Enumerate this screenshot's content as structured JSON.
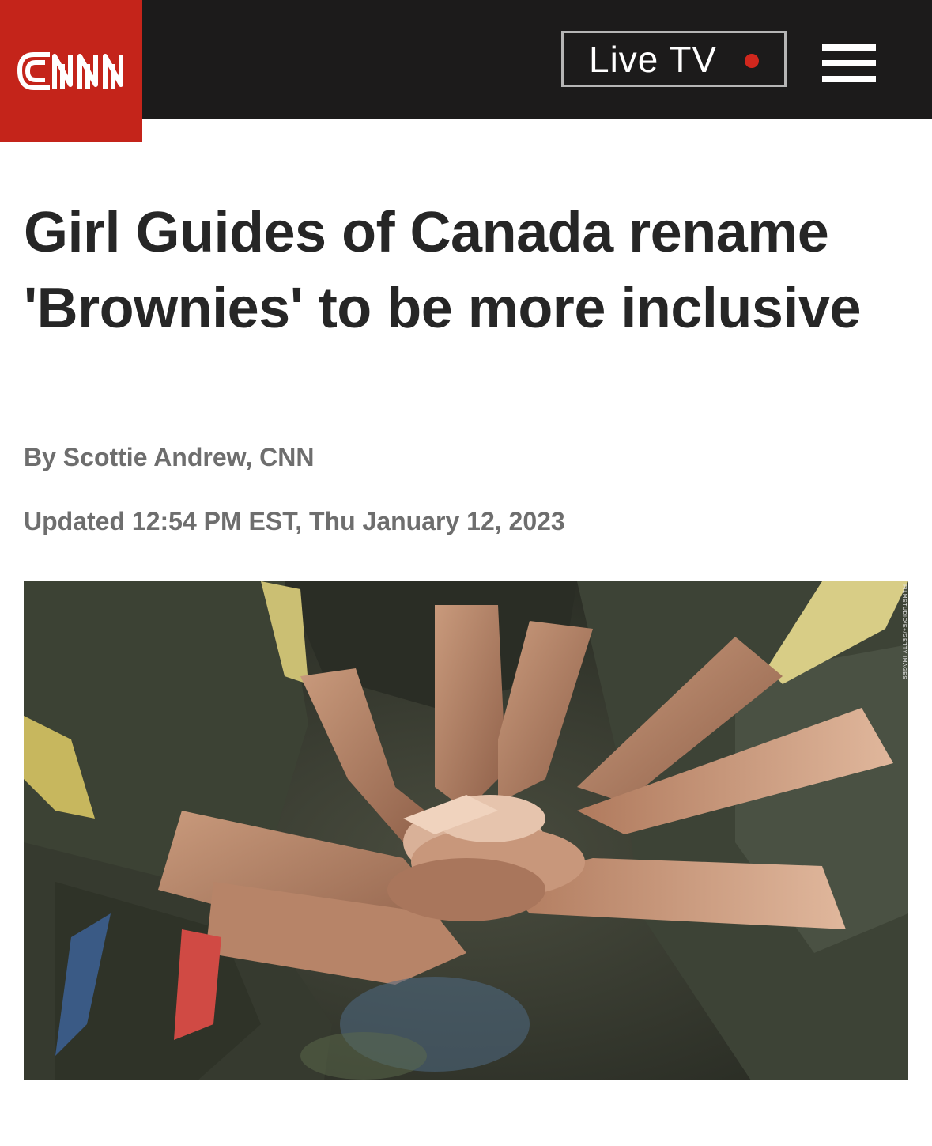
{
  "header": {
    "logo_text": "CNN",
    "live_tv_label": "Live TV",
    "colors": {
      "brand_red": "#c4241a",
      "bar": "#1c1b1b",
      "live_dot": "#d0271d"
    },
    "icons": [
      "cnn-logo",
      "live-dot-icon",
      "hamburger-menu-icon"
    ]
  },
  "article": {
    "headline": "Girl Guides of Canada rename 'Brownies' to be more inclusive",
    "byline": "By Scottie Andrew, CNN",
    "updated": "Updated 12:54 PM EST, Thu January 12, 2023",
    "image_credit": "FILMSTUDIO/E+/GETTY IMAGES"
  }
}
